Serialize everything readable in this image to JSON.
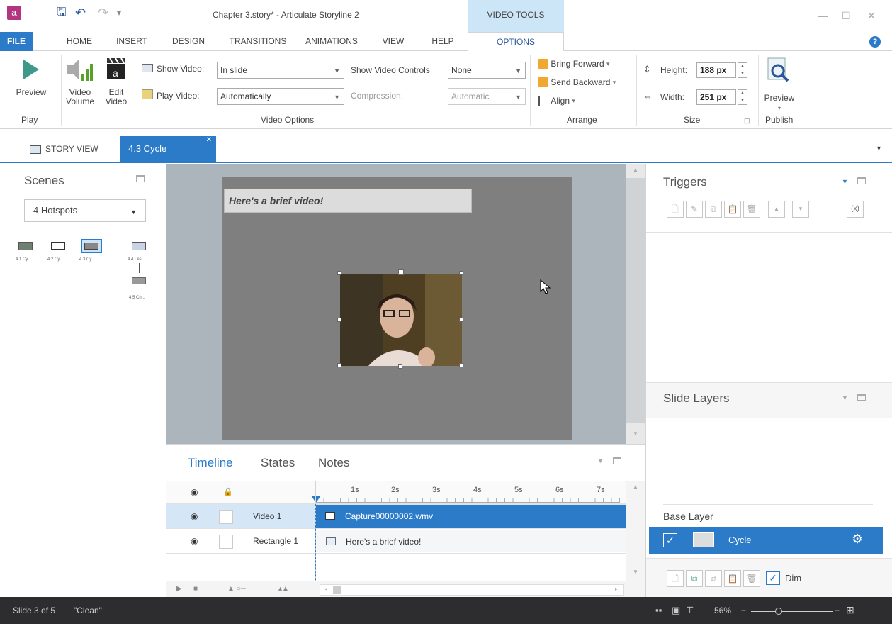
{
  "window": {
    "title": "Chapter 3.story* - Articulate Storyline 2",
    "contextual_group": "VIDEO TOOLS"
  },
  "colors": {
    "accent": "#2b7bc9",
    "app_icon": "#b3357f",
    "status_bg": "#2d2d30",
    "canvas_bg": "#adb5bc",
    "slide_bg": "#7f7f7f"
  },
  "tabs": [
    "FILE",
    "HOME",
    "INSERT",
    "DESIGN",
    "TRANSITIONS",
    "ANIMATIONS",
    "VIEW",
    "HELP",
    "OPTIONS"
  ],
  "ribbon": {
    "play": {
      "preview_label": "Preview",
      "group_label": "Play"
    },
    "video_options": {
      "video_volume_label": "Video\nVolume",
      "edit_video_label": "Edit\nVideo",
      "show_video_label": "Show Video:",
      "show_video_value": "In slide",
      "play_video_label": "Play Video:",
      "play_video_value": "Automatically",
      "show_controls_label": "Show Video Controls",
      "show_controls_value": "None",
      "compression_label": "Compression:",
      "compression_value": "Automatic",
      "group_label": "Video Options"
    },
    "arrange": {
      "bring_forward": "Bring Forward",
      "send_backward": "Send Backward",
      "align": "Align",
      "group_label": "Arrange"
    },
    "size": {
      "height_label": "Height:",
      "height_value": "188 px",
      "width_label": "Width:",
      "width_value": "251 px",
      "group_label": "Size"
    },
    "publish": {
      "preview_label": "Preview",
      "group_label": "Publish"
    }
  },
  "doc_tabs": {
    "story_view": "STORY VIEW",
    "active": "4.3 Cycle"
  },
  "scenes": {
    "title": "Scenes",
    "selected_scene": "4 Hotspots",
    "slides": [
      {
        "label": "4.1 Cy..."
      },
      {
        "label": "4.2 Cy..."
      },
      {
        "label": "4.3 Cy..."
      },
      {
        "label": "4.4 Les..."
      },
      {
        "label": "4.5 Ch..."
      }
    ]
  },
  "slide": {
    "caption": "Here's a brief video!"
  },
  "timeline": {
    "tabs": [
      "Timeline",
      "States",
      "Notes"
    ],
    "ticks": [
      "1s",
      "2s",
      "3s",
      "4s",
      "5s",
      "6s",
      "7s"
    ],
    "rows": [
      {
        "name": "Video 1",
        "bar": "Capture00000002.wmv",
        "selected": true
      },
      {
        "name": "Rectangle 1",
        "bar": "Here's a brief video!",
        "selected": false
      }
    ]
  },
  "triggers": {
    "title": "Triggers"
  },
  "layers": {
    "title": "Slide Layers",
    "base_layer_label": "Base Layer",
    "base_layer_name": "Cycle",
    "dim_label": "Dim"
  },
  "status": {
    "slide_info": "Slide 3 of 5",
    "theme": "\"Clean\"",
    "zoom": "56%"
  }
}
